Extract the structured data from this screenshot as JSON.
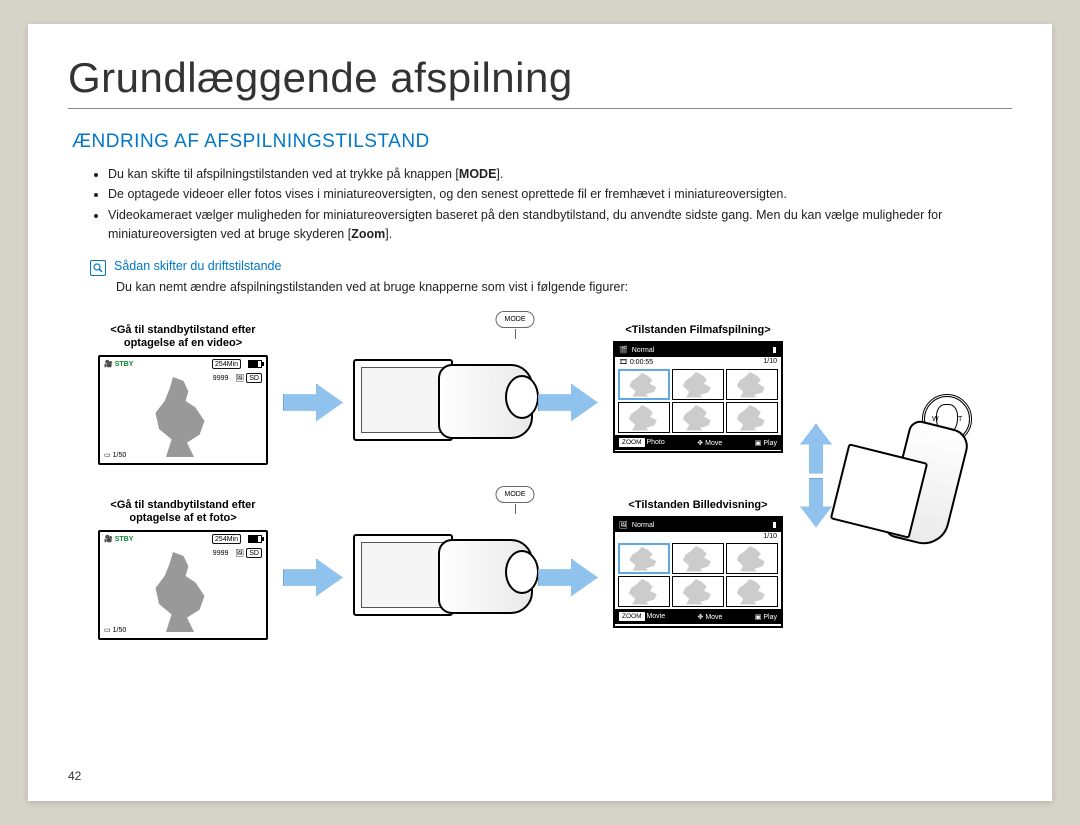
{
  "page": {
    "title": "Grundlæggende afspilning",
    "section_heading": "ÆNDRING AF AFSPILNINGSTILSTAND",
    "number": "42"
  },
  "bullets": {
    "b1_pre": "Du kan skifte til afspilningstilstanden ved at trykke på knappen [",
    "b1_bold": "MODE",
    "b1_post": "].",
    "b2": "De optagede videoer eller fotos vises i miniatureoversigten, og den senest oprettede fil er fremhævet i miniatureoversigten.",
    "b3_pre": "Videokameraet vælger muligheden for miniatureoversigten baseret på den standbytilstand, du anvendte sidste gang. Men du kan vælge muligheder for miniatureoversigten ved at bruge skyderen [",
    "b3_bold": "Zoom",
    "b3_post": "]."
  },
  "callout": {
    "title": "Sådan skifter du driftstilstande",
    "body": "Du kan nemt ændre afspilningstilstanden ved at bruge knapperne som vist i følgende figurer:"
  },
  "figures": {
    "left_top_caption": "<Gå til standbytilstand efter optagelse af en video>",
    "left_bottom_caption": "<Gå til standbytilstand efter optagelse af et foto>",
    "right_top_caption": "<Tilstanden Filmafspilning>",
    "right_bottom_caption": "<Tilstanden Billedvisning>"
  },
  "lcd": {
    "stby": "STBY",
    "time_remain": "254Min",
    "counter": "9999",
    "ratio": "1/50",
    "sd": "SD"
  },
  "thumb": {
    "normal": "Normal",
    "duration": "0:00:55",
    "page": "1/10",
    "zoom": "ZOOM",
    "photo": "Photo",
    "movie": "Movie",
    "move": "Move",
    "play": "Play"
  },
  "labels": {
    "mode": "MODE",
    "w": "W",
    "t": "T"
  }
}
